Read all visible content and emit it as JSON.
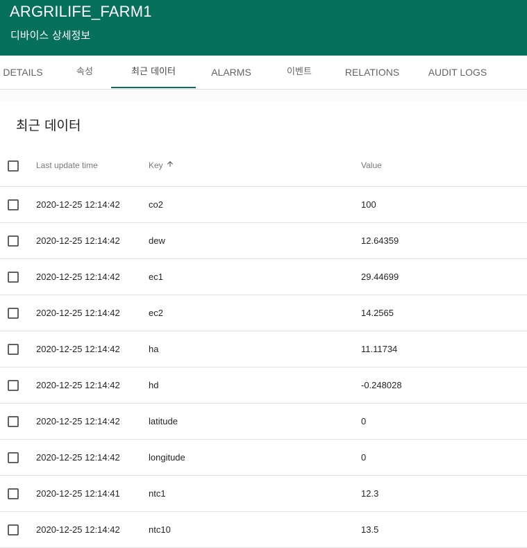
{
  "header": {
    "title": "ARGRILIFE_FARM1",
    "subtitle": "디바이스 상세정보"
  },
  "tabs": [
    {
      "label": "DETAILS"
    },
    {
      "label": "속성"
    },
    {
      "label": "최근 데이터",
      "active": true
    },
    {
      "label": "ALARMS"
    },
    {
      "label": "이벤트"
    },
    {
      "label": "RELATIONS"
    },
    {
      "label": "AUDIT LOGS"
    }
  ],
  "card": {
    "title": "최근 데이터"
  },
  "table": {
    "columns": {
      "time": "Last update time",
      "key": "Key",
      "value": "Value"
    },
    "sort_icon": "arrow-upward-icon",
    "rows": [
      {
        "time": "2020-12-25 12:14:42",
        "key": "co2",
        "value": "100"
      },
      {
        "time": "2020-12-25 12:14:42",
        "key": "dew",
        "value": "12.64359"
      },
      {
        "time": "2020-12-25 12:14:42",
        "key": "ec1",
        "value": "29.44699"
      },
      {
        "time": "2020-12-25 12:14:42",
        "key": "ec2",
        "value": "14.2565"
      },
      {
        "time": "2020-12-25 12:14:42",
        "key": "ha",
        "value": "11.11734"
      },
      {
        "time": "2020-12-25 12:14:42",
        "key": "hd",
        "value": "-0.248028"
      },
      {
        "time": "2020-12-25 12:14:42",
        "key": "latitude",
        "value": "0"
      },
      {
        "time": "2020-12-25 12:14:42",
        "key": "longitude",
        "value": "0"
      },
      {
        "time": "2020-12-25 12:14:41",
        "key": "ntc1",
        "value": "12.3"
      },
      {
        "time": "2020-12-25 12:14:42",
        "key": "ntc10",
        "value": "13.5"
      }
    ]
  },
  "colors": {
    "header_bg": "#07705a",
    "accent": "#07705a"
  }
}
